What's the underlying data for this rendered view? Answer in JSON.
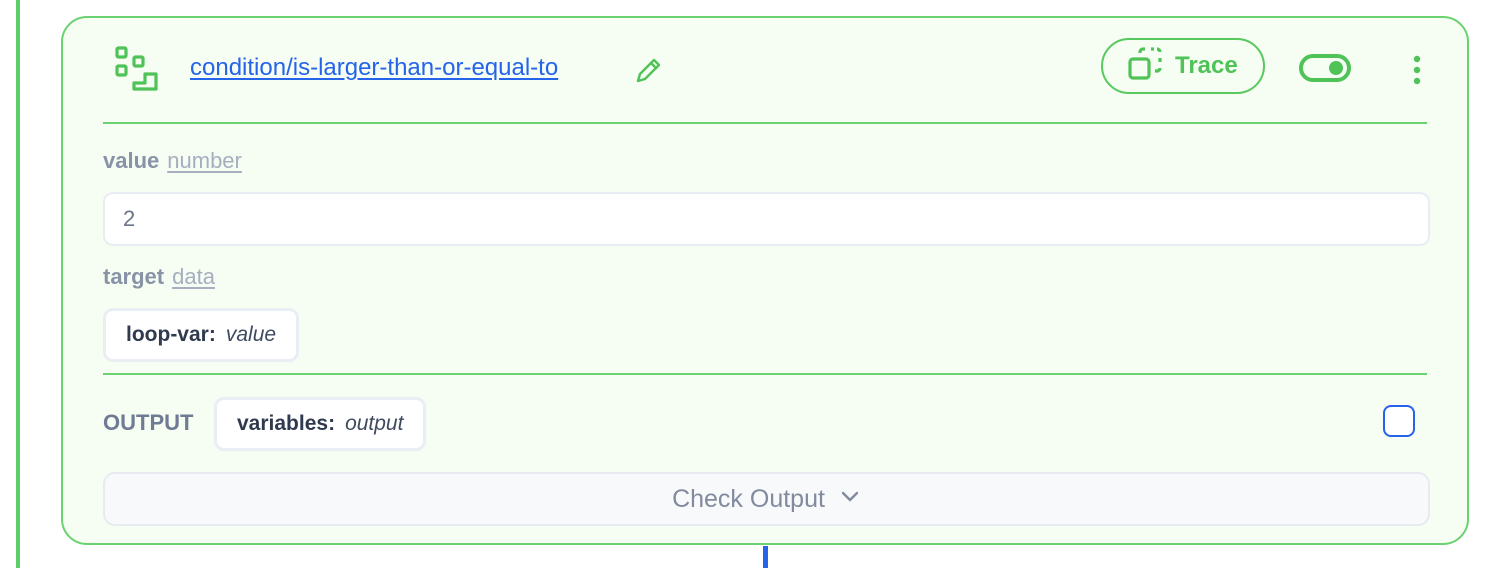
{
  "node": {
    "title": "condition/is-larger-than-or-equal-to",
    "icon": "workflow-steps-icon",
    "accent_color": "#4fc357",
    "border_color": "#6bd271",
    "link_color": "#2563eb",
    "trace_label": "Trace",
    "enabled": true
  },
  "params": [
    {
      "name": "value",
      "type": "number",
      "value": "2"
    },
    {
      "name": "target",
      "type": "data",
      "chip_key": "loop-var:",
      "chip_value": "value"
    }
  ],
  "output": {
    "label": "OUTPUT",
    "chip_key": "variables:",
    "chip_value": "output",
    "checked": false
  },
  "check_output": {
    "label": "Check Output"
  }
}
